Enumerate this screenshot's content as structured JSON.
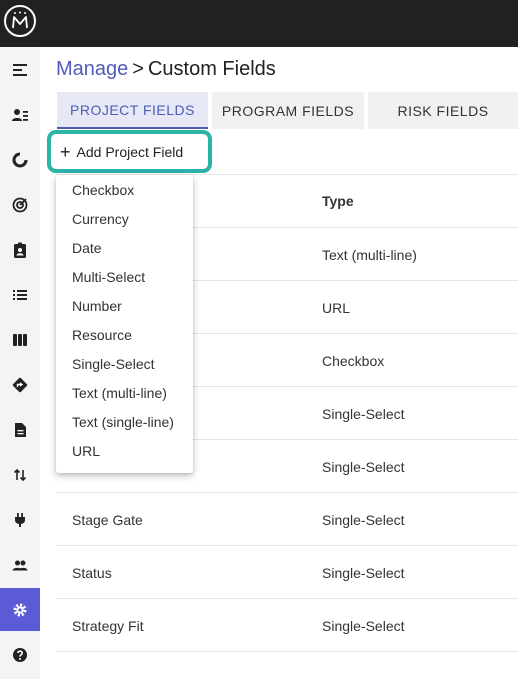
{
  "app": {
    "logo_name": "app-logo"
  },
  "sidebar": {
    "items": [
      {
        "icon": "menu-collapse-icon",
        "active": false
      },
      {
        "icon": "user-list-icon",
        "active": false
      },
      {
        "icon": "donut-chart-icon",
        "active": false
      },
      {
        "icon": "target-icon",
        "active": false
      },
      {
        "icon": "clipboard-user-icon",
        "active": false
      },
      {
        "icon": "list-icon",
        "active": false
      },
      {
        "icon": "board-columns-icon",
        "active": false
      },
      {
        "icon": "directions-icon",
        "active": false
      },
      {
        "icon": "document-icon",
        "active": false
      },
      {
        "icon": "sort-arrows-icon",
        "active": false
      },
      {
        "icon": "plug-icon",
        "active": false
      },
      {
        "icon": "people-icon",
        "active": false
      },
      {
        "icon": "gear-icon",
        "active": true
      },
      {
        "icon": "help-icon",
        "active": false
      }
    ],
    "active_color": "#5b5bd6"
  },
  "breadcrumb": {
    "parent": "Manage",
    "separator": ">",
    "current": "Custom Fields"
  },
  "tabs": [
    {
      "label": "PROJECT FIELDS",
      "active": true
    },
    {
      "label": "PROGRAM FIELDS",
      "active": false
    },
    {
      "label": "RISK FIELDS",
      "active": false
    }
  ],
  "toolbar": {
    "add_label": "Add Project Field",
    "highlight_color": "#2bb3a7"
  },
  "table": {
    "type_header": "Type",
    "rows": [
      {
        "name": "",
        "type": "Text (multi-line)"
      },
      {
        "name": "",
        "type": "URL"
      },
      {
        "name": "",
        "type": "Checkbox"
      },
      {
        "name": "",
        "type": "Single-Select"
      },
      {
        "name": "",
        "type": "Single-Select"
      },
      {
        "name": "Stage Gate",
        "type": "Single-Select"
      },
      {
        "name": "Status",
        "type": "Single-Select"
      },
      {
        "name": "Strategy Fit",
        "type": "Single-Select"
      }
    ]
  },
  "dropdown": {
    "options": [
      "Checkbox",
      "Currency",
      "Date",
      "Multi-Select",
      "Number",
      "Resource",
      "Single-Select",
      "Text (multi-line)",
      "Text (single-line)",
      "URL"
    ]
  }
}
